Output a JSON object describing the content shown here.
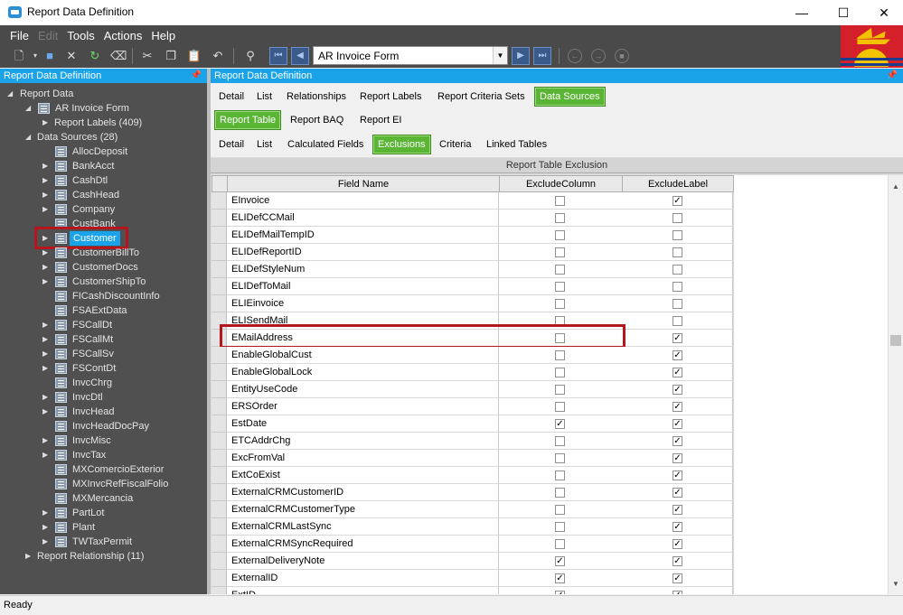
{
  "window": {
    "title": "Report Data Definition",
    "controls": {
      "minimize": "—",
      "maximize": "☐",
      "close": "✕"
    }
  },
  "menu": [
    {
      "label": "File",
      "enabled": true
    },
    {
      "label": "Edit",
      "enabled": false
    },
    {
      "label": "Tools",
      "enabled": true
    },
    {
      "label": "Actions",
      "enabled": true
    },
    {
      "label": "Help",
      "enabled": true
    }
  ],
  "toolbar": {
    "icons": [
      "new-icon",
      "save-icon",
      "delete-icon",
      "refresh-icon",
      "clear-icon",
      "cut-icon",
      "copy-icon",
      "paste-icon",
      "undo-icon",
      "search-icon",
      "first-record-icon",
      "previous-record-icon",
      "next-record-icon",
      "last-record-icon",
      "back-icon",
      "forward-icon",
      "stop-icon"
    ],
    "form_select": {
      "value": "AR Invoice Form"
    }
  },
  "left_panel": {
    "header": "Report Data Definition",
    "tree": {
      "root": "Report Data",
      "form": "AR Invoice Form",
      "report_labels": "Report Labels (409)",
      "data_sources": "Data Sources (28)",
      "sources": [
        "AllocDeposit",
        "BankAcct",
        "CashDtl",
        "CashHead",
        "Company",
        "CustBank",
        "Customer",
        "CustomerBillTo",
        "CustomerDocs",
        "CustomerShipTo",
        "FICashDiscountInfo",
        "FSAExtData",
        "FSCallDt",
        "FSCallMt",
        "FSCallSv",
        "FSContDt",
        "InvcChrg",
        "InvcDtl",
        "InvcHead",
        "InvcHeadDocPay",
        "InvcMisc",
        "InvcTax",
        "MXComercioExterior",
        "MXInvcRefFiscalFolio",
        "MXMercancia",
        "PartLot",
        "Plant",
        "TWTaxPermit"
      ],
      "selected_source": "Customer",
      "report_relationship": "Report Relationship (11)"
    }
  },
  "right_panel": {
    "header": "Report Data Definition",
    "tabs_level1": [
      "Detail",
      "List",
      "Relationships",
      "Report Labels",
      "Report Criteria Sets",
      "Data Sources"
    ],
    "active_level1": "Data Sources",
    "tabs_level2": [
      "Report Table",
      "Report BAQ",
      "Report EI"
    ],
    "active_level2": "Report Table",
    "tabs_level3": [
      "Detail",
      "List",
      "Calculated Fields",
      "Exclusions",
      "Criteria",
      "Linked Tables"
    ],
    "active_level3": "Exclusions",
    "grid": {
      "caption": "Report Table Exclusion",
      "columns": [
        "Field Name",
        "ExcludeColumn",
        "ExcludeLabel"
      ],
      "rows": [
        {
          "field": "EInvoice",
          "exclude_column": false,
          "exclude_label": true
        },
        {
          "field": "ELIDefCCMail",
          "exclude_column": false,
          "exclude_label": false
        },
        {
          "field": "ELIDefMailTempID",
          "exclude_column": false,
          "exclude_label": false
        },
        {
          "field": "ELIDefReportID",
          "exclude_column": false,
          "exclude_label": false
        },
        {
          "field": "ELIDefStyleNum",
          "exclude_column": false,
          "exclude_label": false
        },
        {
          "field": "ELIDefToMail",
          "exclude_column": false,
          "exclude_label": false
        },
        {
          "field": "ELIEinvoice",
          "exclude_column": false,
          "exclude_label": false
        },
        {
          "field": "ELISendMail",
          "exclude_column": false,
          "exclude_label": false
        },
        {
          "field": "EMailAddress",
          "exclude_column": false,
          "exclude_label": true
        },
        {
          "field": "EnableGlobalCust",
          "exclude_column": false,
          "exclude_label": true
        },
        {
          "field": "EnableGlobalLock",
          "exclude_column": false,
          "exclude_label": true
        },
        {
          "field": "EntityUseCode",
          "exclude_column": false,
          "exclude_label": true
        },
        {
          "field": "ERSOrder",
          "exclude_column": false,
          "exclude_label": true
        },
        {
          "field": "EstDate",
          "exclude_column": true,
          "exclude_label": true
        },
        {
          "field": "ETCAddrChg",
          "exclude_column": false,
          "exclude_label": true
        },
        {
          "field": "ExcFromVal",
          "exclude_column": false,
          "exclude_label": true
        },
        {
          "field": "ExtCoExist",
          "exclude_column": false,
          "exclude_label": true
        },
        {
          "field": "ExternalCRMCustomerID",
          "exclude_column": false,
          "exclude_label": true
        },
        {
          "field": "ExternalCRMCustomerType",
          "exclude_column": false,
          "exclude_label": true
        },
        {
          "field": "ExternalCRMLastSync",
          "exclude_column": false,
          "exclude_label": true
        },
        {
          "field": "ExternalCRMSyncRequired",
          "exclude_column": false,
          "exclude_label": true
        },
        {
          "field": "ExternalDeliveryNote",
          "exclude_column": true,
          "exclude_label": true
        },
        {
          "field": "ExternalID",
          "exclude_column": true,
          "exclude_label": true
        },
        {
          "field": "ExtID",
          "exclude_column": true,
          "exclude_label": true
        }
      ],
      "highlighted_field": "EMailAddress"
    }
  },
  "status": {
    "text": "Ready"
  },
  "colors": {
    "accent_blue": "#1aa3e8",
    "active_tab_green": "#5bb535",
    "highlight_red": "#b5151d",
    "tree_background": "#505050"
  }
}
